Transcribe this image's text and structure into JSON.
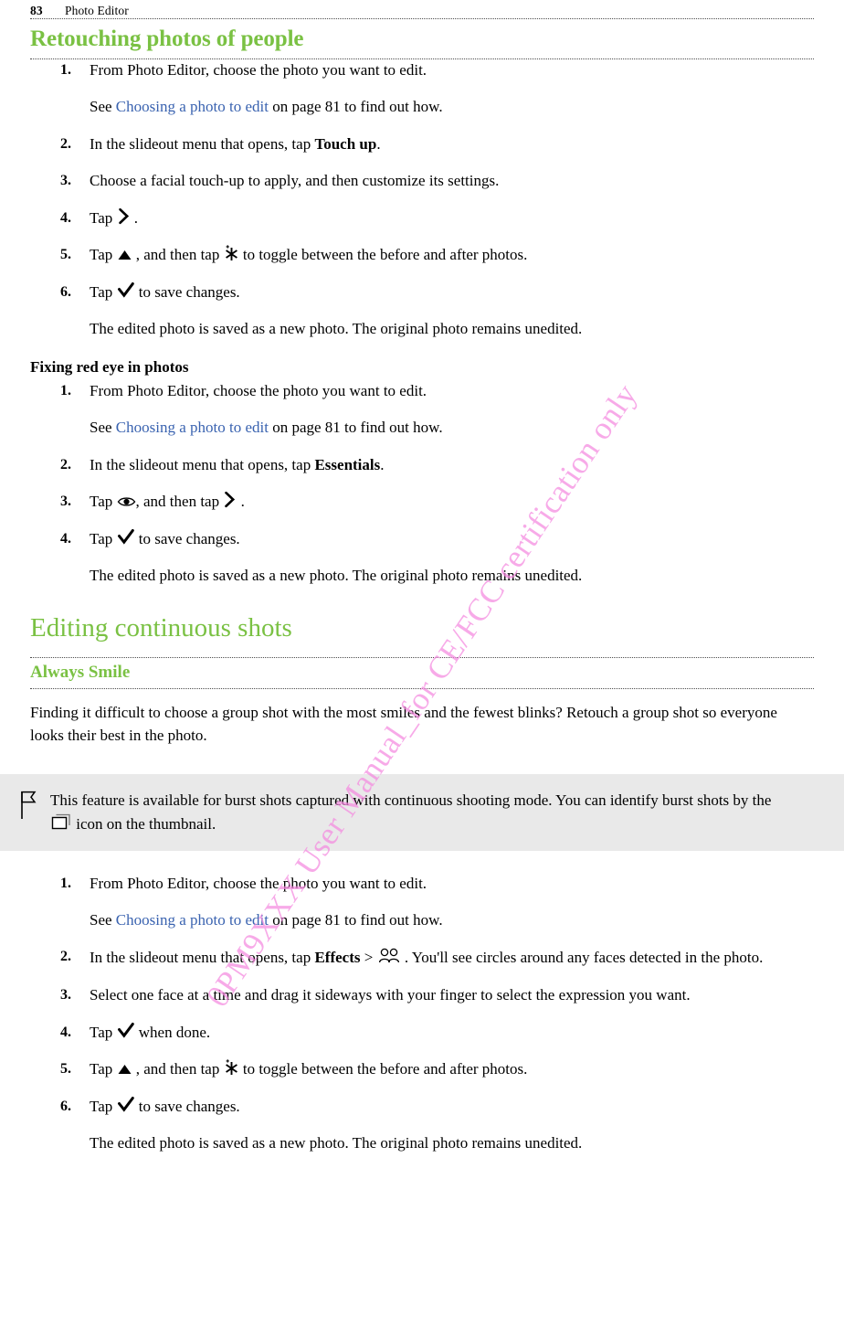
{
  "header": {
    "page_number": "83",
    "section_title": "Photo Editor"
  },
  "watermark": {
    "text": "0PM9XXX User Manual_for CE/FCC certification only",
    "color": "#f58ae0"
  },
  "colors": {
    "heading_green": "#7ac143",
    "link_blue": "#3a63b0",
    "note_background": "#e9e9e9"
  },
  "sections": {
    "retouching": {
      "heading": "Retouching photos of people",
      "steps": [
        {
          "num": "1.",
          "text": "From Photo Editor, choose the photo you want to edit.",
          "sub_pre": "See ",
          "sub_link": "Choosing a photo to edit",
          "sub_post": " on page 81 to find out how."
        },
        {
          "num": "2.",
          "pre": "In the slideout menu that opens, tap ",
          "bold": "Touch up",
          "post": "."
        },
        {
          "num": "3.",
          "text": "Choose a facial touch-up to apply, and then customize its settings."
        },
        {
          "num": "4.",
          "pre": "Tap ",
          "icon": "chevron-right-icon",
          "post": " ."
        },
        {
          "num": "5.",
          "pre": "Tap ",
          "icon": "triangle-up-icon",
          "mid": " , and then tap ",
          "icon2": "sparkle-icon",
          "post": " to toggle between the before and after photos."
        },
        {
          "num": "6.",
          "pre": "Tap ",
          "icon": "check-icon",
          "post": " to save changes.",
          "sub": "The edited photo is saved as a new photo. The original photo remains unedited."
        }
      ]
    },
    "redeye": {
      "heading": "Fixing red eye in photos",
      "steps": [
        {
          "num": "1.",
          "text": "From Photo Editor, choose the photo you want to edit.",
          "sub_pre": "See ",
          "sub_link": "Choosing a photo to edit",
          "sub_post": " on page 81 to find out how."
        },
        {
          "num": "2.",
          "pre": "In the slideout menu that opens, tap ",
          "bold": "Essentials",
          "post": "."
        },
        {
          "num": "3.",
          "pre": "Tap ",
          "icon": "eye-icon",
          "mid": ", and then tap ",
          "icon2": "chevron-right-icon",
          "post": " ."
        },
        {
          "num": "4.",
          "pre": "Tap ",
          "icon": "check-icon",
          "post": " to save changes.",
          "sub": "The edited photo is saved as a new photo. The original photo remains unedited."
        }
      ]
    },
    "continuous": {
      "heading": "Editing continuous shots",
      "subheading": "Always Smile",
      "intro": "Finding it difficult to choose a group shot with the most smiles and the fewest blinks? Retouch a group shot so everyone looks their best in the photo.",
      "note": {
        "icon": "flag-icon",
        "pre": "This feature is available for burst shots captured with continuous shooting mode. You can identify burst shots by the ",
        "inline_icon": "burst-shot-icon",
        "post": " icon on the thumbnail."
      },
      "steps": [
        {
          "num": "1.",
          "text": "From Photo Editor, choose the photo you want to edit.",
          "sub_pre": "See ",
          "sub_link": "Choosing a photo to edit",
          "sub_post": " on page 81 to find out how."
        },
        {
          "num": "2.",
          "pre": "In the slideout menu that opens, tap ",
          "bold": "Effects",
          "mid": " > ",
          "icon2": "faces-icon",
          "post": " . You'll see circles around any faces detected in the photo."
        },
        {
          "num": "3.",
          "text": "Select one face at a time and drag it sideways with your finger to select the expression you want."
        },
        {
          "num": "4.",
          "pre": "Tap ",
          "icon": "check-icon",
          "post": " when done."
        },
        {
          "num": "5.",
          "pre": "Tap ",
          "icon": "triangle-up-icon",
          "mid": " , and then tap ",
          "icon2": "sparkle-icon",
          "post": " to toggle between the before and after photos."
        },
        {
          "num": "6.",
          "pre": "Tap ",
          "icon": "check-icon",
          "post": " to save changes.",
          "sub": "The edited photo is saved as a new photo. The original photo remains unedited."
        }
      ]
    }
  }
}
